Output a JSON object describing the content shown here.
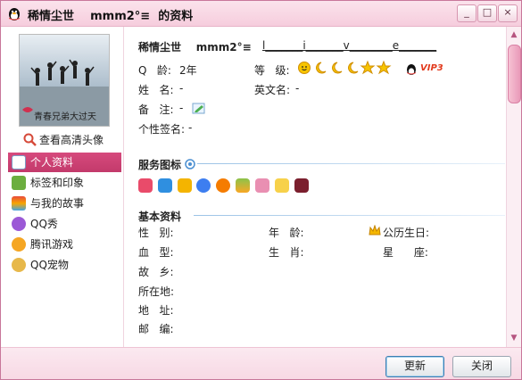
{
  "window": {
    "title": "稀情尘世    mmm2°≡  的资料",
    "controls": [
      "_",
      "□",
      "×"
    ]
  },
  "left": {
    "hd_link": "查看高清头像",
    "avatar_caption": "青春兄弟大过天",
    "nav": [
      {
        "label": "个人资料",
        "icon": "person-card-icon",
        "active": true
      },
      {
        "label": "标签和印象",
        "icon": "tag-icon",
        "active": false
      },
      {
        "label": "与我的故事",
        "icon": "rainbow-icon",
        "active": false
      },
      {
        "label": "QQ秀",
        "icon": "qq-show-icon",
        "active": false
      },
      {
        "label": "腾讯游戏",
        "icon": "game-icon",
        "active": false
      },
      {
        "label": "QQ宠物",
        "icon": "pet-icon",
        "active": false
      }
    ]
  },
  "profile": {
    "display_name": "稀情尘世    mmm2°≡",
    "signature_preview": "l_______i_______v________e_______",
    "q_age_label": "Q   龄:",
    "q_age_value": "2年",
    "level_label": "等   级:",
    "vip_label": "VIP3",
    "name_label": "姓   名:",
    "name_value": "-",
    "english_name_label": "英文名:",
    "english_name_value": "-",
    "remark_label": "备   注:",
    "remark_value": "-",
    "signature_label": "个性签名:",
    "signature_value": "-"
  },
  "services": {
    "title": "服务图标",
    "icons": [
      "heart-icon",
      "qzone-icon",
      "wallet-icon",
      "pai-icon",
      "pai-orange-icon",
      "stack-icon",
      "avatar-show-icon",
      "qq-mail-icon",
      "brand-icon"
    ]
  },
  "basic": {
    "title": "基本资料",
    "gender_label": "性   别:",
    "age_label": "年   龄:",
    "birthday_label": "公历生日:",
    "blood_label": "血   型:",
    "zodiac_label": "生   肖:",
    "star_label": "星      座:",
    "hometown_label": "故   乡:",
    "location_label": "所在地:",
    "address_label": "地   址:",
    "postcode_label": "邮   编:"
  },
  "buttons": {
    "refresh": "更新",
    "close": "关闭"
  },
  "colors": {
    "accent": "#c33a6b",
    "titlebar": "#f6cddd",
    "section_line": "#9cc3e6"
  }
}
